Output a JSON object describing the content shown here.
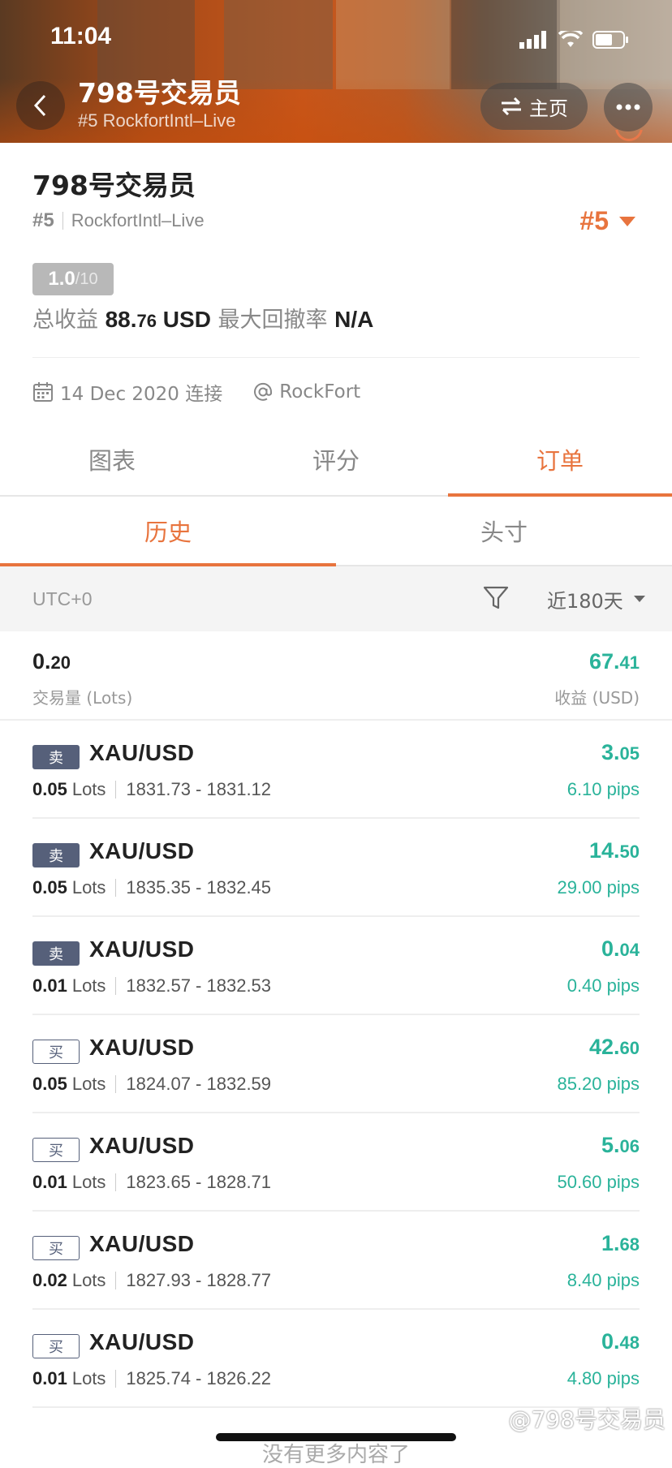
{
  "status_bar": {
    "time": "11:04"
  },
  "header": {
    "title": "798号交易员",
    "subtitle": "#5 RockfortIntl–Live",
    "home_label": "主页"
  },
  "profile": {
    "name": "798号交易员",
    "rank": "#5",
    "account": "RockfortIntl–Live",
    "rank_badge": "#5",
    "score": "1.0",
    "score_max": "/10",
    "total_profit_label": "总收益",
    "total_profit_int": "88.",
    "total_profit_dec": "76",
    "total_profit_unit": "USD",
    "max_drawdown_label": "最大回撤率",
    "max_drawdown_value": "N/A",
    "connected_date": "14 Dec 2020 连接",
    "broker": "RockFort"
  },
  "main_tabs": [
    "图表",
    "评分",
    "订单"
  ],
  "sub_tabs": [
    "历史",
    "头寸"
  ],
  "filter": {
    "timezone": "UTC+0",
    "period": "近180天"
  },
  "summary": {
    "volume_int": "0.",
    "volume_dec": "20",
    "volume_label": "交易量 (Lots)",
    "profit_int": "67.",
    "profit_dec": "41",
    "profit_label": "收益 (USD)"
  },
  "orders": [
    {
      "side": "卖",
      "type": "sell",
      "symbol": "XAU/USD",
      "lots": "0.05",
      "unit": "Lots",
      "range": "1831.73 - 1831.12",
      "profit_int": "3.",
      "profit_dec": "05",
      "pips": "6.10 pips"
    },
    {
      "side": "卖",
      "type": "sell",
      "symbol": "XAU/USD",
      "lots": "0.05",
      "unit": "Lots",
      "range": "1835.35 - 1832.45",
      "profit_int": "14.",
      "profit_dec": "50",
      "pips": "29.00 pips"
    },
    {
      "side": "卖",
      "type": "sell",
      "symbol": "XAU/USD",
      "lots": "0.01",
      "unit": "Lots",
      "range": "1832.57 - 1832.53",
      "profit_int": "0.",
      "profit_dec": "04",
      "pips": "0.40 pips"
    },
    {
      "side": "买",
      "type": "buy",
      "symbol": "XAU/USD",
      "lots": "0.05",
      "unit": "Lots",
      "range": "1824.07 - 1832.59",
      "profit_int": "42.",
      "profit_dec": "60",
      "pips": "85.20 pips"
    },
    {
      "side": "买",
      "type": "buy",
      "symbol": "XAU/USD",
      "lots": "0.01",
      "unit": "Lots",
      "range": "1823.65 - 1828.71",
      "profit_int": "5.",
      "profit_dec": "06",
      "pips": "50.60 pips"
    },
    {
      "side": "买",
      "type": "buy",
      "symbol": "XAU/USD",
      "lots": "0.02",
      "unit": "Lots",
      "range": "1827.93 - 1828.77",
      "profit_int": "1.",
      "profit_dec": "68",
      "pips": "8.40 pips"
    },
    {
      "side": "买",
      "type": "buy",
      "symbol": "XAU/USD",
      "lots": "0.01",
      "unit": "Lots",
      "range": "1825.74 - 1826.22",
      "profit_int": "0.",
      "profit_dec": "48",
      "pips": "4.80 pips"
    }
  ],
  "footer": {
    "more_text": "没有更多内容了",
    "watermark": "@798号交易员"
  },
  "colors": {
    "accent": "#e8743e",
    "profit_green": "#2ab39a",
    "sell_tag": "#56607a"
  }
}
